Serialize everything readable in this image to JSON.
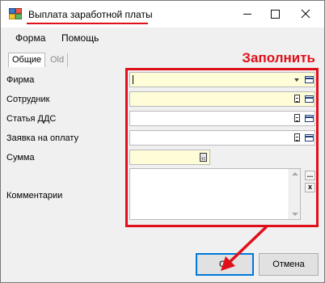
{
  "window": {
    "title": "Выплата заработной платы"
  },
  "menu": {
    "items": [
      "Форма",
      "Помощь"
    ]
  },
  "tabs": {
    "active": "Общие",
    "inactive": "Old"
  },
  "annotation": {
    "label": "Заполнить",
    "color": "#e0101a"
  },
  "fields": {
    "firm": {
      "label": "Фирма",
      "value": ""
    },
    "employee": {
      "label": "Сотрудник",
      "value": ""
    },
    "dds_article": {
      "label": "Статья ДДС",
      "value": ""
    },
    "payment_request": {
      "label": "Заявка на оплату",
      "value": ""
    },
    "amount": {
      "label": "Сумма",
      "value": ""
    },
    "comments": {
      "label": "Комментарии",
      "value": ""
    }
  },
  "side_buttons": {
    "more": "...",
    "clear": "x"
  },
  "buttons": {
    "ok": "Ok",
    "cancel": "Отмена"
  },
  "colors": {
    "required_field": "#fffdd8",
    "accent": "#0078d7"
  }
}
